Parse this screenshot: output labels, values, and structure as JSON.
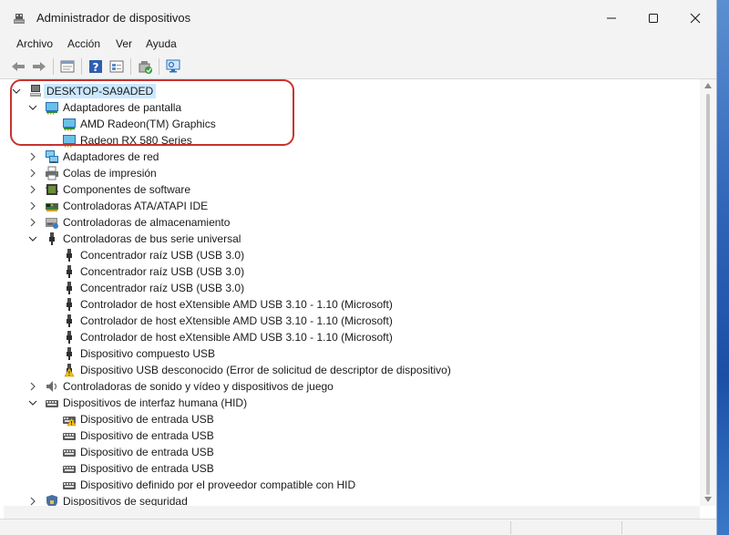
{
  "window": {
    "title": "Administrador de dispositivos"
  },
  "menu": [
    "Archivo",
    "Acción",
    "Ver",
    "Ayuda"
  ],
  "toolbar": [
    "back-icon",
    "forward-icon",
    "properties-icon",
    "help-icon",
    "device-view-icon",
    "update-driver-icon",
    "monitor-scan-icon"
  ],
  "tree": [
    {
      "label": "DESKTOP-SA9ADED",
      "level": 0,
      "state": "expanded",
      "icon": "computer-icon",
      "selected": true
    },
    {
      "label": "Adaptadores de pantalla",
      "level": 1,
      "state": "expanded",
      "icon": "display-adapter-icon"
    },
    {
      "label": "AMD Radeon(TM) Graphics",
      "level": 2,
      "state": "leaf",
      "icon": "display-adapter-icon"
    },
    {
      "label": "Radeon RX 580 Series",
      "level": 2,
      "state": "leaf",
      "icon": "display-adapter-icon"
    },
    {
      "label": "Adaptadores de red",
      "level": 1,
      "state": "collapsed",
      "icon": "network-icon"
    },
    {
      "label": "Colas de impresión",
      "level": 1,
      "state": "collapsed",
      "icon": "printer-icon"
    },
    {
      "label": "Componentes de software",
      "level": 1,
      "state": "collapsed",
      "icon": "software-component-icon"
    },
    {
      "label": "Controladoras ATA/ATAPI IDE",
      "level": 1,
      "state": "collapsed",
      "icon": "ide-controller-icon"
    },
    {
      "label": "Controladoras de almacenamiento",
      "level": 1,
      "state": "collapsed",
      "icon": "storage-controller-icon"
    },
    {
      "label": "Controladoras de bus serie universal",
      "level": 1,
      "state": "expanded",
      "icon": "usb-icon"
    },
    {
      "label": "Concentrador raíz USB (USB 3.0)",
      "level": 2,
      "state": "leaf",
      "icon": "usb-icon"
    },
    {
      "label": "Concentrador raíz USB (USB 3.0)",
      "level": 2,
      "state": "leaf",
      "icon": "usb-icon"
    },
    {
      "label": "Concentrador raíz USB (USB 3.0)",
      "level": 2,
      "state": "leaf",
      "icon": "usb-icon"
    },
    {
      "label": "Controlador de host eXtensible AMD USB 3.10 - 1.10 (Microsoft)",
      "level": 2,
      "state": "leaf",
      "icon": "usb-icon"
    },
    {
      "label": "Controlador de host eXtensible AMD USB 3.10 - 1.10 (Microsoft)",
      "level": 2,
      "state": "leaf",
      "icon": "usb-icon"
    },
    {
      "label": "Controlador de host eXtensible AMD USB 3.10 - 1.10 (Microsoft)",
      "level": 2,
      "state": "leaf",
      "icon": "usb-icon"
    },
    {
      "label": "Dispositivo compuesto USB",
      "level": 2,
      "state": "leaf",
      "icon": "usb-icon"
    },
    {
      "label": "Dispositivo USB desconocido (Error de solicitud de descriptor de dispositivo)",
      "level": 2,
      "state": "leaf",
      "icon": "warning-icon"
    },
    {
      "label": "Controladoras de sonido y vídeo y dispositivos de juego",
      "level": 1,
      "state": "collapsed",
      "icon": "speaker-icon"
    },
    {
      "label": "Dispositivos de interfaz humana (HID)",
      "level": 1,
      "state": "expanded",
      "icon": "hid-icon"
    },
    {
      "label": "Dispositivo de entrada USB",
      "level": 2,
      "state": "leaf",
      "icon": "hid-warning-icon"
    },
    {
      "label": "Dispositivo de entrada USB",
      "level": 2,
      "state": "leaf",
      "icon": "hid-icon"
    },
    {
      "label": "Dispositivo de entrada USB",
      "level": 2,
      "state": "leaf",
      "icon": "hid-icon"
    },
    {
      "label": "Dispositivo de entrada USB",
      "level": 2,
      "state": "leaf",
      "icon": "hid-icon"
    },
    {
      "label": "Dispositivo definido por el proveedor compatible con HID",
      "level": 2,
      "state": "leaf",
      "icon": "hid-icon"
    },
    {
      "label": "Dispositivos de seguridad",
      "level": 1,
      "state": "collapsed",
      "icon": "security-icon"
    }
  ],
  "colors": {
    "highlight": "#c8322f",
    "selection": "#cce8ff"
  }
}
